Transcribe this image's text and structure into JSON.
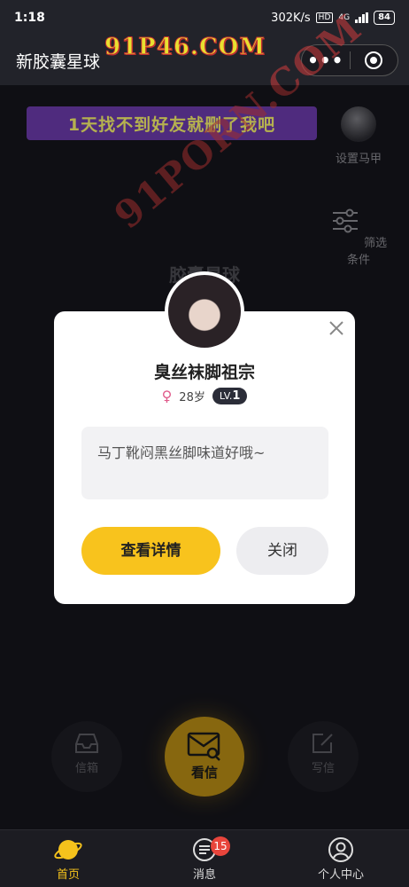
{
  "status_bar": {
    "time": "1:18",
    "network_speed": "302K/s",
    "hd_label": "HD",
    "signal_label": "4G",
    "battery": "84"
  },
  "header": {
    "title": "新胶囊星球",
    "capsule_more": "•••"
  },
  "watermarks": {
    "top": "91P46.COM",
    "diagonal": "91PORN.COM"
  },
  "banner": {
    "text": "1天找不到好友就删了我吧"
  },
  "side_actions": {
    "set_persona": "设置马甲",
    "filter": "筛选条件"
  },
  "background_title": "胶囊星球",
  "modal": {
    "name": "臭丝袜脚祖宗",
    "gender_symbol": "♀",
    "age": "28岁",
    "level_prefix": "LV.",
    "level_value": "1",
    "message": "马丁靴闷黑丝脚味道好哦~",
    "detail_button": "查看详情",
    "close_button": "关闭"
  },
  "actions": {
    "inbox": "信箱",
    "read_letter": "看信",
    "write_letter": "写信"
  },
  "tabbar": {
    "home": "首页",
    "messages": "消息",
    "messages_badge": "15",
    "profile": "个人中心"
  },
  "colors": {
    "accent_yellow": "#f8c31d",
    "banner_purple": "#6a3aa8",
    "badge_red": "#e8453c",
    "background": "#15151b"
  }
}
